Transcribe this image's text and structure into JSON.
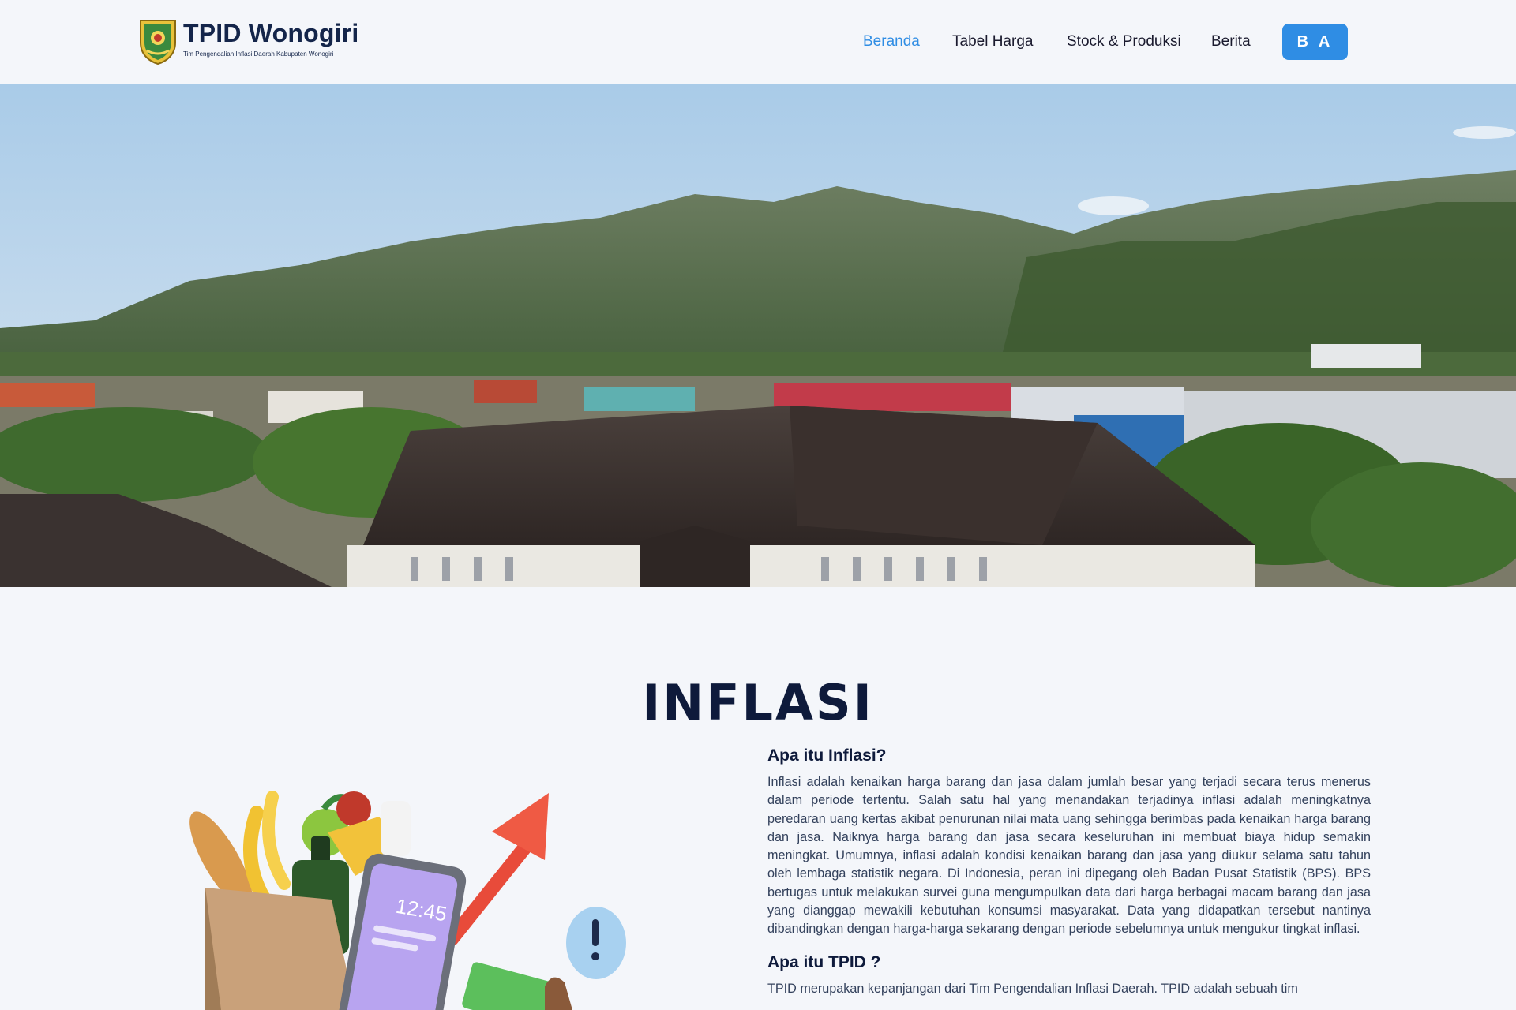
{
  "header": {
    "logo_title": "TPID Wonogiri",
    "logo_subtitle": "Tim Pengendalian Inflasi Daerah Kabupaten Wonogiri",
    "nav": [
      {
        "label": "Beranda",
        "active": true
      },
      {
        "label": "Tabel Harga",
        "active": false
      },
      {
        "label": "Stock & Produksi",
        "active": false
      },
      {
        "label": "Berita",
        "active": false
      }
    ],
    "user_button": "B A",
    "accent_color": "#2f8de4"
  },
  "main": {
    "section_title": "INFLASI",
    "q1_title": "Apa itu Inflasi?",
    "q1_body": "Inflasi adalah kenaikan harga barang dan jasa dalam jumlah besar yang terjadi secara terus menerus dalam periode tertentu. Salah satu hal yang menandakan terjadinya inflasi adalah meningkatnya peredaran uang kertas akibat penurunan nilai mata uang sehingga berimbas pada kenaikan harga barang dan jasa. Naiknya harga barang dan jasa secara keseluruhan ini membuat biaya hidup semakin meningkat. Umumnya, inflasi adalah kondisi kenaikan barang dan jasa yang diukur selama satu tahun oleh lembaga statistik negara. Di Indonesia, peran ini dipegang oleh Badan Pusat Statistik (BPS). BPS bertugas untuk melakukan survei guna mengumpulkan data dari harga berbagai macam barang dan jasa yang dianggap mewakili kebutuhan konsumsi masyarakat. Data yang didapatkan tersebut nantinya dibandingkan dengan harga-harga sekarang dengan periode sebelumnya untuk mengukur tingkat inflasi.",
    "q2_title": "Apa itu TPID ?",
    "q2_body": "TPID merupakan kepanjangan dari Tim Pengendalian Inflasi Daerah. TPID adalah sebuah tim",
    "illustration_clock": "12:45"
  }
}
